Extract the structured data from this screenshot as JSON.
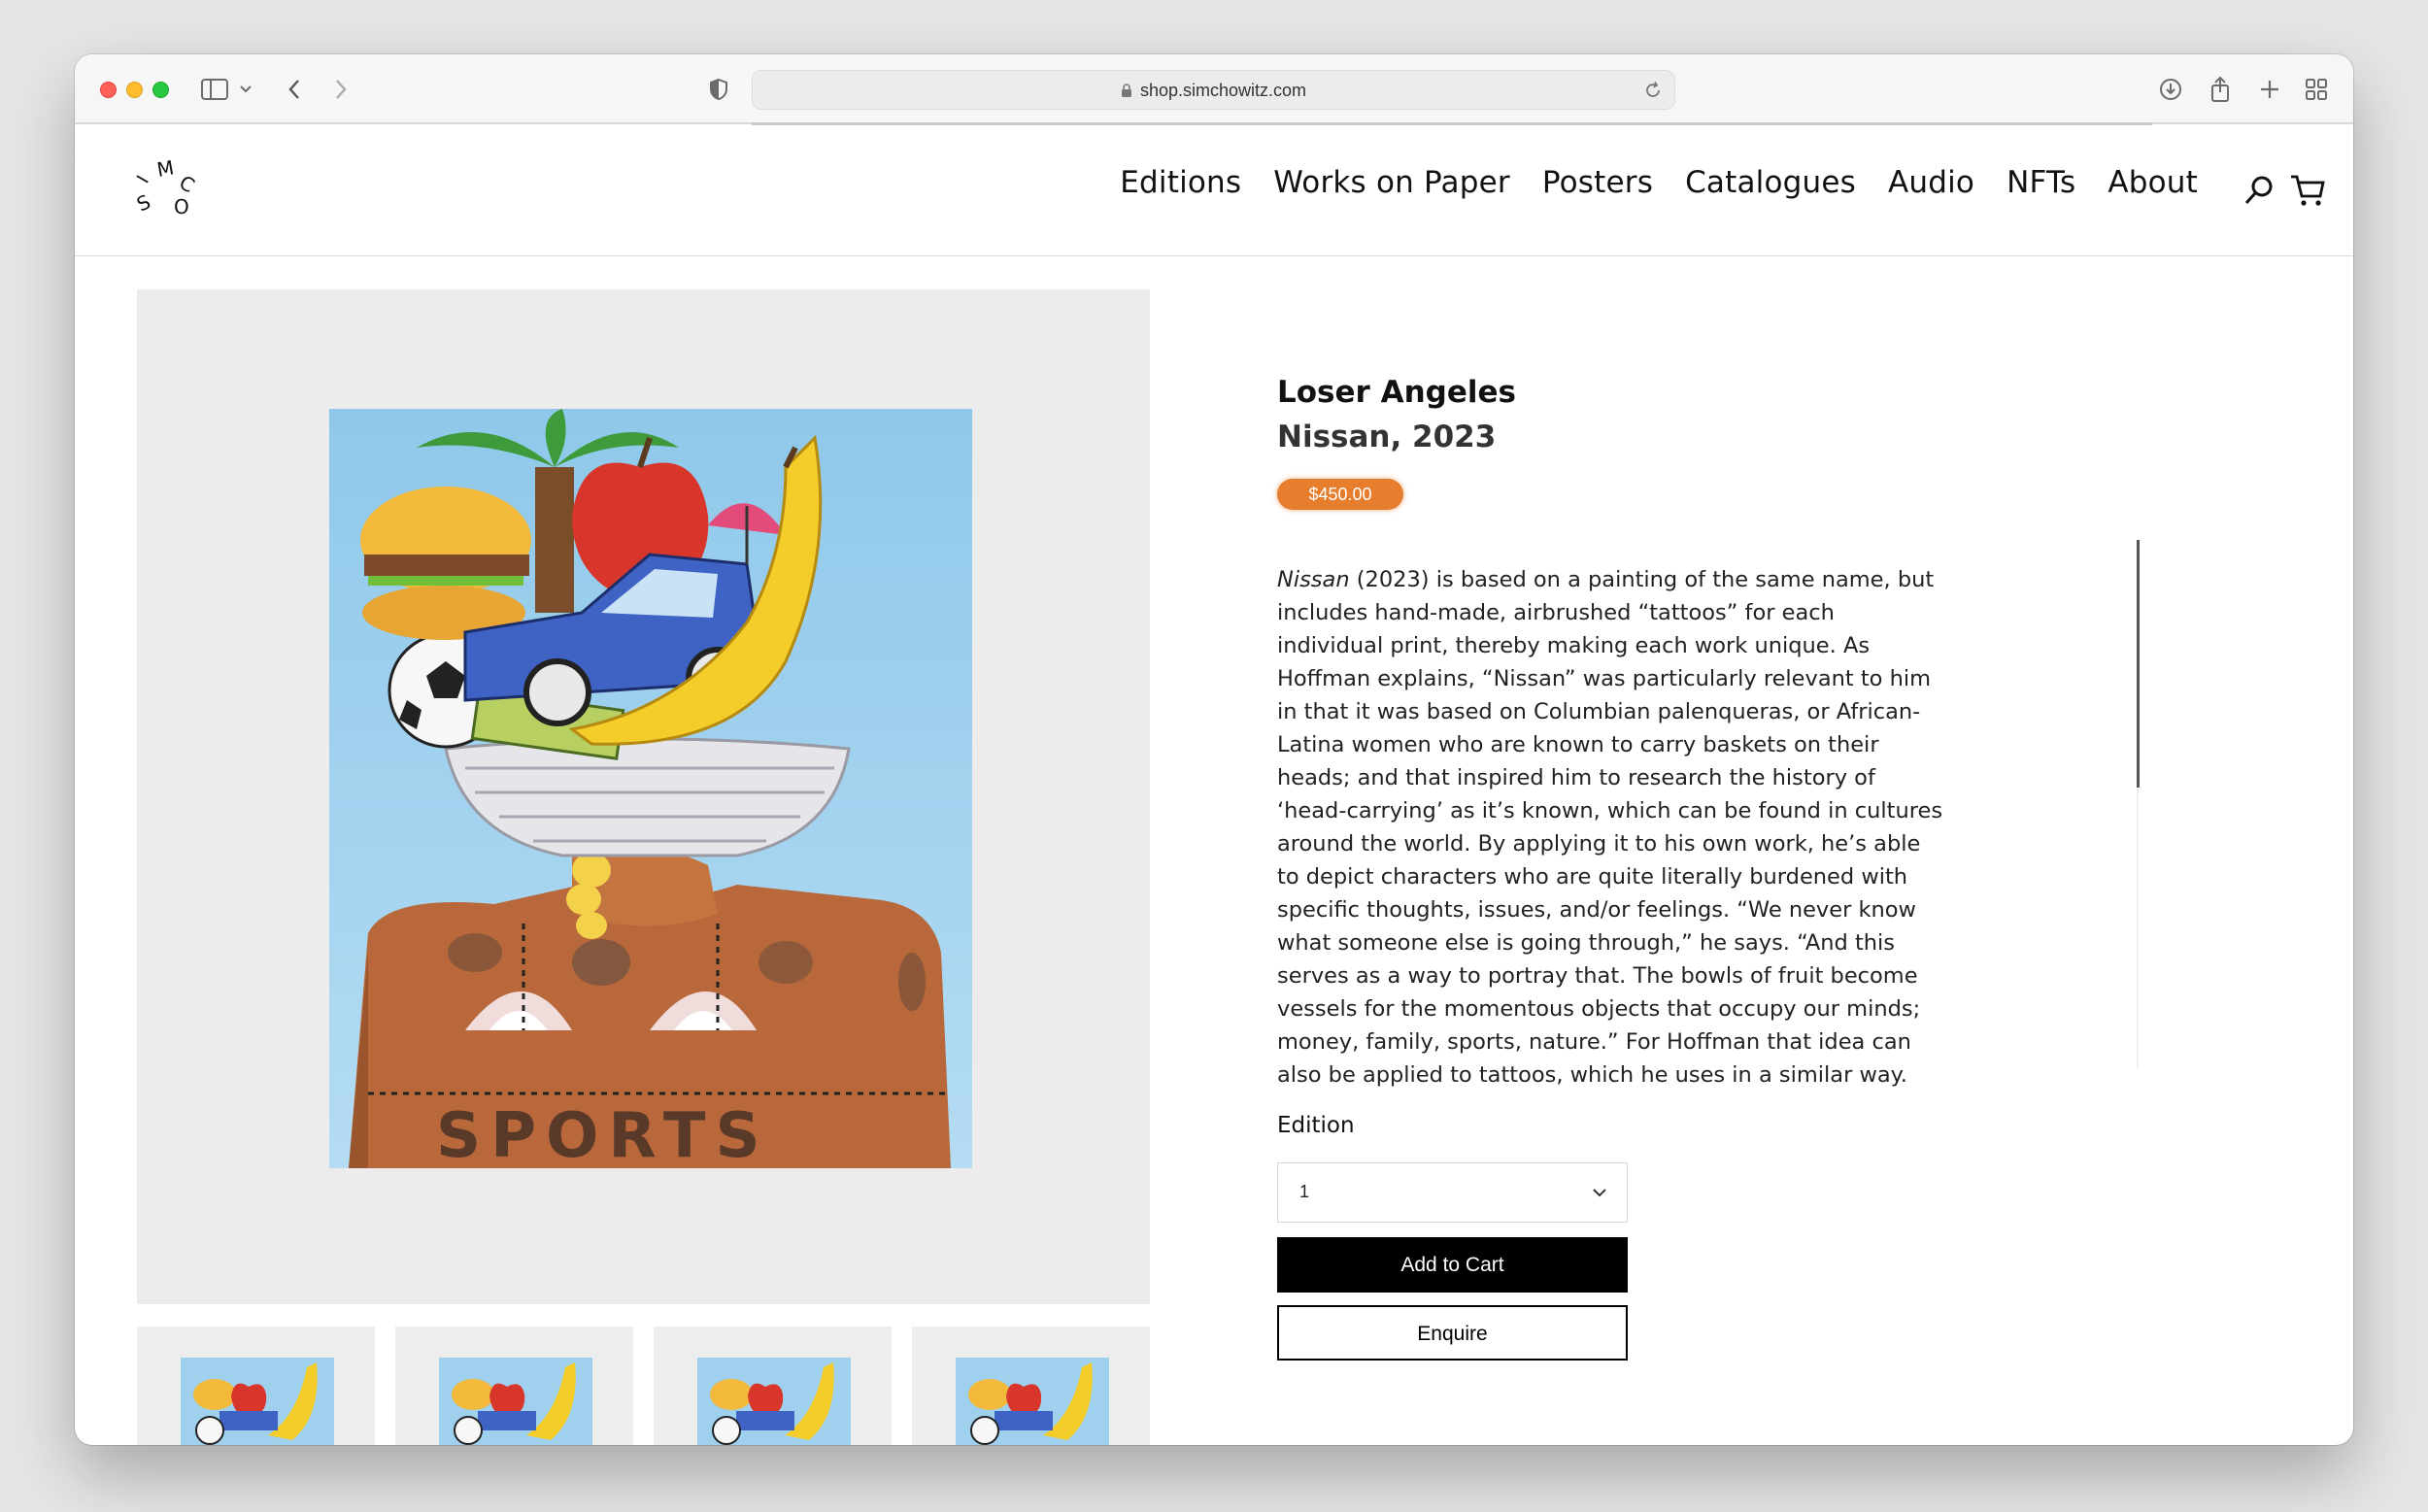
{
  "browser": {
    "url": "shop.simchowitz.com"
  },
  "site": {
    "logo_letters": "SIMCO",
    "nav": [
      "Editions",
      "Works on Paper",
      "Posters",
      "Catalogues",
      "Audio",
      "NFTs",
      "About"
    ]
  },
  "product": {
    "artist": "Loser Angeles",
    "title_year": "Nissan, 2023",
    "price": "$450.00",
    "description_italic": "Nissan",
    "description": " (2023) is based on a painting of the same name, but includes hand-made, airbrushed “tattoos” for each individual print, thereby making each work unique. As Hoffman explains, “Nissan” was particularly relevant to him in that it was based on Columbian palenqueras, or African-Latina women who are known to carry baskets on their heads; and that inspired him to research the history of ‘head-carrying’ as it’s known, which can be found in cultures around the world. By applying it to his own work, he’s able to depict characters who are quite literally burdened with specific thoughts, issues, and/or feelings. “We never know what someone else is going through,” he says. “And this serves as a way to portray that. The bowls of fruit become vessels for the momentous objects that occupy our minds; money, family, sports, nature.” For Hoffman that idea can also be applied to tattoos, which he uses in a similar way.",
    "edition_label": "Edition",
    "edition_value": "1",
    "add_to_cart": "Add to Cart",
    "enquire": "Enquire",
    "painting_text": "SPORTS"
  },
  "colors": {
    "price_badge": "#e67e2e",
    "primary_button": "#000000"
  }
}
